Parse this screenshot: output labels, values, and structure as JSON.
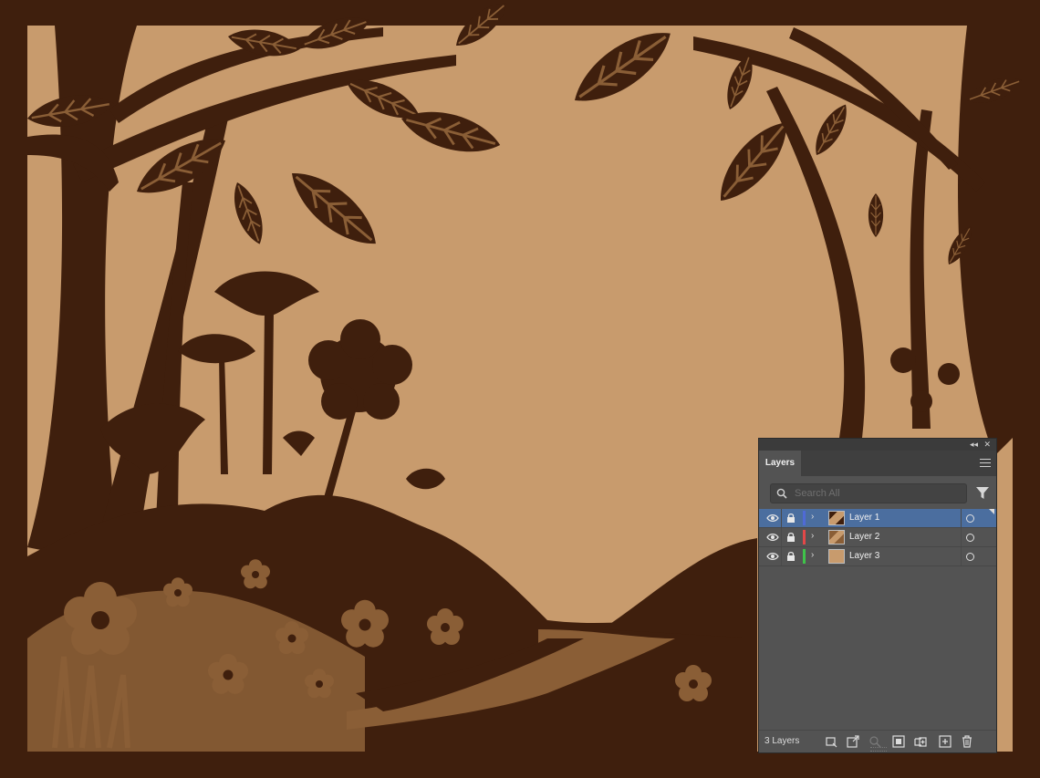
{
  "colors": {
    "frame": "#3f1f0d",
    "sky": "#c89b6d",
    "mid_tone": "#8a5e36",
    "panel_bg": "#535353",
    "selection": "#4b6e9f"
  },
  "artwork": {
    "description_icon": "paper-cut-forest-scene"
  },
  "panel": {
    "tab_label": "Layers",
    "search_placeholder": "Search All",
    "layer_count": "3 Layers",
    "layers": [
      {
        "name": "Layer 1",
        "color": "#4f6ad6",
        "selected": true
      },
      {
        "name": "Layer 2",
        "color": "#e24848",
        "selected": false
      },
      {
        "name": "Layer 3",
        "color": "#3fc34a",
        "selected": false
      }
    ],
    "footer_icons": [
      "collect-for-export-icon",
      "export-icon",
      "locate-object-icon",
      "make-clipping-mask-icon",
      "new-sublayer-icon",
      "new-layer-icon",
      "delete-icon"
    ]
  }
}
